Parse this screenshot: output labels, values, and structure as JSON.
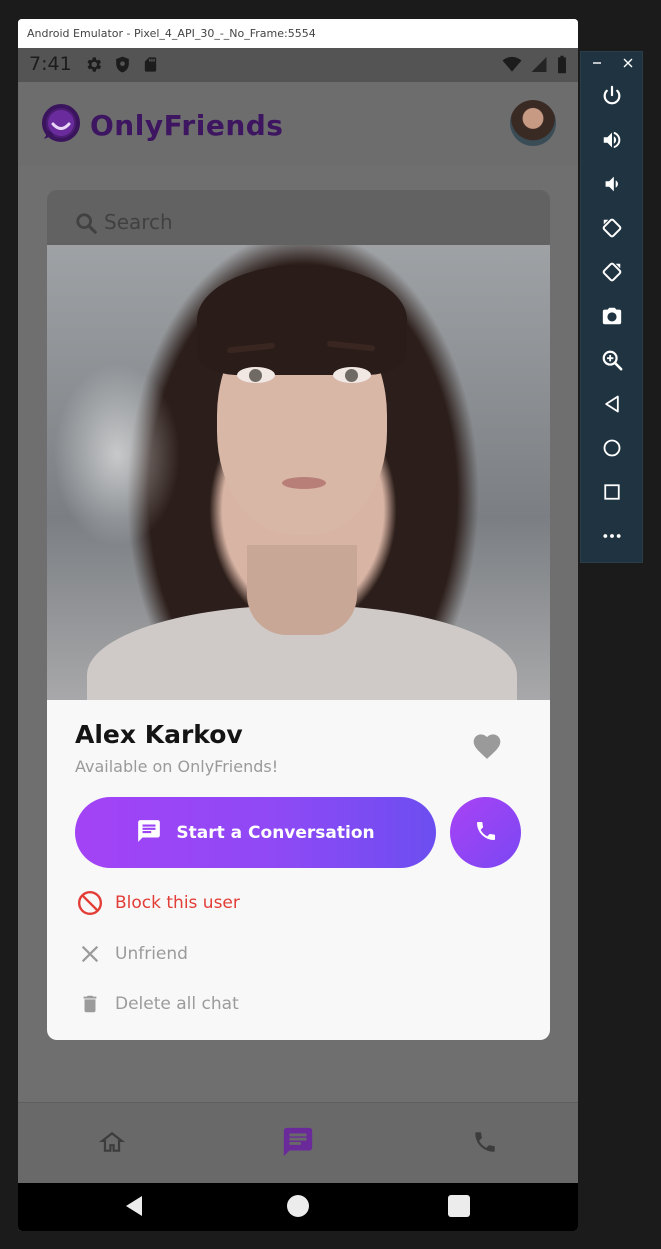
{
  "window": {
    "title": "Android Emulator - Pixel_4_API_30_-_No_Frame:5554"
  },
  "status_bar": {
    "time": "7:41",
    "left_icons": [
      "gear-icon",
      "shield-icon",
      "sd-card-icon"
    ],
    "right_icons": [
      "wifi-icon",
      "signal-icon",
      "battery-icon"
    ]
  },
  "app_bar": {
    "logo_text": "OnlyFriends",
    "brand_color": "#3d1560"
  },
  "search": {
    "placeholder": "Search"
  },
  "profile": {
    "name": "Alex Karkov",
    "status": "Available on OnlyFriends!",
    "favorite_icon": "heart-icon"
  },
  "actions": {
    "start_conversation": "Start a Conversation",
    "call_icon": "phone-icon",
    "block": "Block this user",
    "unfriend": "Unfriend",
    "delete_chat": "Delete all chat",
    "block_color": "#e23d36",
    "accent_gradient": [
      "#a343f6",
      "#6c4ef0"
    ]
  },
  "bottom_nav": {
    "items": [
      "home-icon",
      "chat-icon",
      "phone-icon"
    ],
    "active": "chat-icon",
    "active_color": "#6a2a9a"
  },
  "system_nav": {
    "items": [
      "back-icon",
      "home-icon",
      "recents-icon"
    ]
  },
  "emulator_toolbar": {
    "window_controls": [
      "minimize-icon",
      "close-icon"
    ],
    "buttons": [
      "power-icon",
      "volume-up-icon",
      "volume-down-icon",
      "rotate-left-icon",
      "rotate-right-icon",
      "camera-icon",
      "zoom-icon",
      "back-icon",
      "home-icon",
      "overview-icon",
      "more-icon"
    ]
  }
}
